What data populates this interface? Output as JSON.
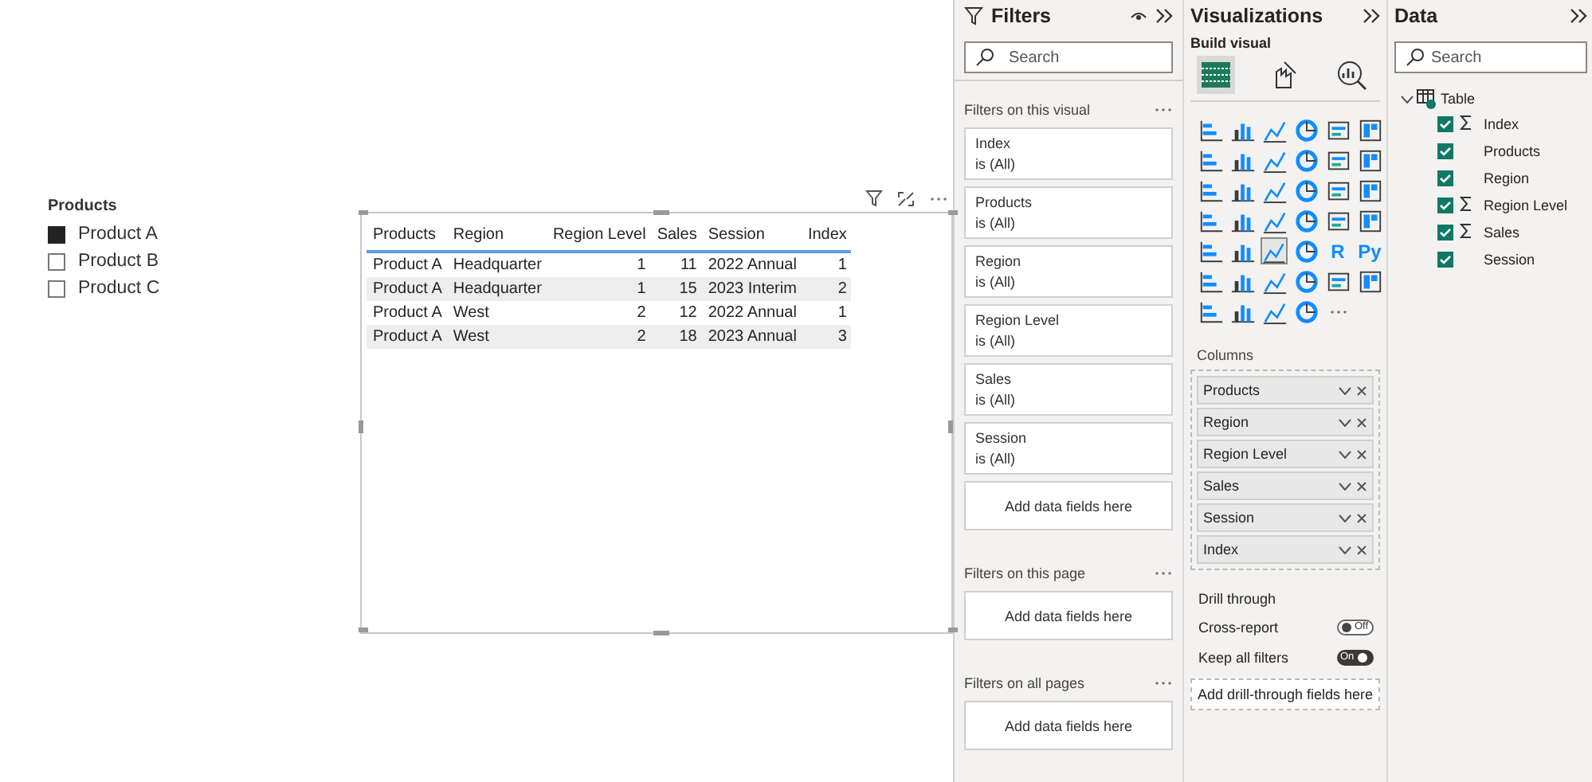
{
  "slicer": {
    "title": "Products",
    "items": [
      {
        "label": "Product A",
        "checked": true
      },
      {
        "label": "Product B",
        "checked": false
      },
      {
        "label": "Product C",
        "checked": false
      }
    ]
  },
  "table": {
    "columns": [
      {
        "label": "Products",
        "kind": "text"
      },
      {
        "label": "Region",
        "kind": "text"
      },
      {
        "label": "Region Level",
        "kind": "number"
      },
      {
        "label": "Sales",
        "kind": "number"
      },
      {
        "label": "Session",
        "kind": "text"
      },
      {
        "label": "Index",
        "kind": "number"
      }
    ],
    "rows": [
      [
        "Product A",
        "Headquarter",
        "1",
        "11",
        "2022 Annual",
        "1"
      ],
      [
        "Product A",
        "Headquarter",
        "1",
        "15",
        "2023 Interim",
        "2"
      ],
      [
        "Product A",
        "West",
        "2",
        "12",
        "2022 Annual",
        "1"
      ],
      [
        "Product A",
        "West",
        "2",
        "18",
        "2023 Annual",
        "3"
      ]
    ]
  },
  "filters": {
    "title": "Filters",
    "search": {
      "placeholder": "Search"
    },
    "sections": [
      {
        "title": "Filters on this visual",
        "cards": [
          {
            "field": "Index",
            "condition": "is (All)"
          },
          {
            "field": "Products",
            "condition": "is (All)"
          },
          {
            "field": "Region",
            "condition": "is (All)"
          },
          {
            "field": "Region Level",
            "condition": "is (All)"
          },
          {
            "field": "Sales",
            "condition": "is (All)"
          },
          {
            "field": "Session",
            "condition": "is (All)"
          }
        ],
        "drop_zone": "Add data fields here"
      },
      {
        "title": "Filters on this page",
        "drop_zone": "Add data fields here"
      },
      {
        "title": "Filters on all pages",
        "drop_zone": "Add data fields here"
      }
    ]
  },
  "visualizations": {
    "title": "Visualizations",
    "subtitle": "Build visual",
    "modes": [
      {
        "selected": true
      },
      {
        "selected": false
      },
      {
        "selected": false
      }
    ],
    "visual_types": [
      {
        "kind": "icon",
        "selected": false
      },
      {
        "kind": "icon",
        "selected": false
      },
      {
        "kind": "icon",
        "selected": false
      },
      {
        "kind": "icon",
        "selected": false
      },
      {
        "kind": "icon",
        "selected": false
      },
      {
        "kind": "icon",
        "selected": false
      },
      {
        "kind": "icon",
        "selected": false
      },
      {
        "kind": "icon",
        "selected": false
      },
      {
        "kind": "icon",
        "selected": false
      },
      {
        "kind": "icon",
        "selected": false
      },
      {
        "kind": "icon",
        "selected": false
      },
      {
        "kind": "icon",
        "selected": false
      },
      {
        "kind": "icon",
        "selected": false
      },
      {
        "kind": "icon",
        "selected": false
      },
      {
        "kind": "icon",
        "selected": false
      },
      {
        "kind": "icon",
        "selected": false
      },
      {
        "kind": "icon",
        "selected": false
      },
      {
        "kind": "icon",
        "selected": false
      },
      {
        "kind": "icon",
        "selected": false
      },
      {
        "kind": "icon",
        "selected": false
      },
      {
        "kind": "icon",
        "selected": false
      },
      {
        "kind": "icon",
        "selected": false
      },
      {
        "kind": "icon",
        "selected": false
      },
      {
        "kind": "icon",
        "selected": false
      },
      {
        "kind": "icon",
        "selected": false
      },
      {
        "kind": "icon",
        "selected": false
      },
      {
        "kind": "icon",
        "selected": true
      },
      {
        "kind": "icon",
        "selected": false
      },
      {
        "kind": "text",
        "label": "R",
        "selected": false
      },
      {
        "kind": "text",
        "label": "Py",
        "selected": false
      },
      {
        "kind": "icon",
        "selected": false
      },
      {
        "kind": "icon",
        "selected": false
      },
      {
        "kind": "icon",
        "selected": false
      },
      {
        "kind": "icon",
        "selected": false
      },
      {
        "kind": "icon",
        "selected": false
      },
      {
        "kind": "icon",
        "selected": false
      },
      {
        "kind": "icon",
        "selected": false
      },
      {
        "kind": "icon",
        "selected": false
      },
      {
        "kind": "icon",
        "selected": false
      },
      {
        "kind": "icon",
        "selected": false
      },
      {
        "kind": "more",
        "selected": false
      }
    ],
    "columns_label": "Columns",
    "columns": [
      "Products",
      "Region",
      "Region Level",
      "Sales",
      "Session",
      "Index"
    ],
    "drill_through": {
      "title": "Drill through",
      "toggles": [
        {
          "label": "Cross-report",
          "on": false,
          "state_label": "Off"
        },
        {
          "label": "Keep all filters",
          "on": true,
          "state_label": "On"
        }
      ],
      "drop_zone": "Add drill-through fields here"
    }
  },
  "data": {
    "title": "Data",
    "search": {
      "placeholder": "Search"
    },
    "table": {
      "name": "Table",
      "expanded": true,
      "fields": [
        {
          "name": "Index",
          "kind": "numeric",
          "checked": true
        },
        {
          "name": "Products",
          "kind": "text",
          "checked": true
        },
        {
          "name": "Region",
          "kind": "text",
          "checked": true
        },
        {
          "name": "Region Level",
          "kind": "numeric",
          "checked": true
        },
        {
          "name": "Sales",
          "kind": "numeric",
          "checked": true
        },
        {
          "name": "Session",
          "kind": "text",
          "checked": true
        }
      ]
    }
  }
}
